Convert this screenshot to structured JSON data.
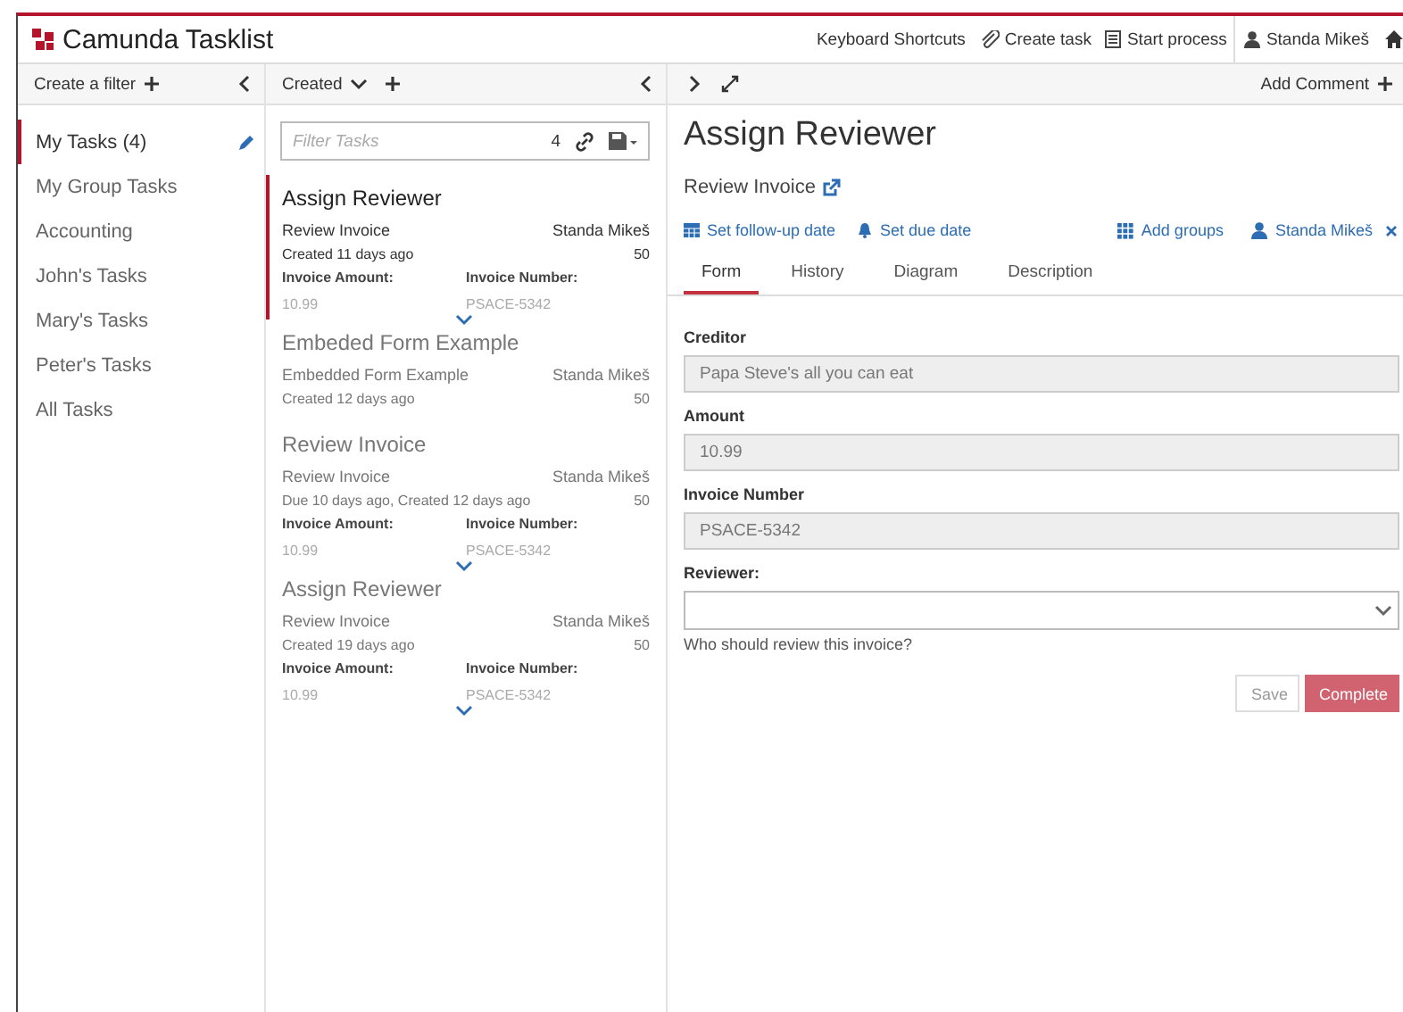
{
  "header": {
    "title": "Camunda Tasklist",
    "links": [
      {
        "kind": "text",
        "label": "Keyboard Shortcuts"
      },
      {
        "kind": "clip",
        "label": "Create task"
      },
      {
        "kind": "process",
        "label": "Start process"
      }
    ],
    "user": "Standa Mikeš"
  },
  "filters": {
    "create": "Create a filter",
    "items": [
      {
        "label": "My Tasks",
        "count": "(4)",
        "selected": true
      },
      {
        "label": "My Group Tasks",
        "selected": false
      },
      {
        "label": "Accounting",
        "selected": false
      },
      {
        "label": "John's Tasks",
        "selected": false
      },
      {
        "label": "Mary's Tasks",
        "selected": false
      },
      {
        "label": "Peter's Tasks",
        "selected": false
      },
      {
        "label": "All Tasks",
        "selected": false
      }
    ]
  },
  "list": {
    "sort": "Created",
    "search": {
      "placeholder": "Filter Tasks",
      "count": "4"
    },
    "tasks": [
      {
        "name": "Assign Reviewer",
        "process": "Review Invoice",
        "assignee": "Standa Mikeš",
        "dates": "Created 11 days ago",
        "priority": "50",
        "selected": true,
        "variables": [
          {
            "label": "Invoice Amount:",
            "value": "10.99"
          },
          {
            "label": "Invoice Number:",
            "value": "PSACE-5342"
          }
        ]
      },
      {
        "name": "Embeded Form Example",
        "process": "Embedded Form Example",
        "assignee": "Standa Mikeš",
        "dates": "Created 12 days ago",
        "priority": "50",
        "selected": false
      },
      {
        "name": "Review Invoice",
        "process": "Review Invoice",
        "assignee": "Standa Mikeš",
        "dates": "Due 10 days ago, Created 12 days ago",
        "priority": "50",
        "selected": false,
        "variables": [
          {
            "label": "Invoice Amount:",
            "value": "10.99"
          },
          {
            "label": "Invoice Number:",
            "value": "PSACE-5342"
          }
        ]
      },
      {
        "name": "Assign Reviewer",
        "process": "Review Invoice",
        "assignee": "Standa Mikeš",
        "dates": "Created 19 days ago",
        "priority": "50",
        "selected": false,
        "variables": [
          {
            "label": "Invoice Amount:",
            "value": "10.99"
          },
          {
            "label": "Invoice Number:",
            "value": "PSACE-5342"
          }
        ]
      }
    ]
  },
  "detail": {
    "add_comment": "Add Comment",
    "title": "Assign Reviewer",
    "process": "Review Invoice",
    "actions": [
      {
        "kind": "calendar",
        "label": "Set follow-up date"
      },
      {
        "kind": "bell",
        "label": "Set due date"
      },
      {
        "kind": "groups",
        "label": "Add groups"
      },
      {
        "kind": "user",
        "label": "Standa Mikeš"
      }
    ],
    "tabs": [
      {
        "label": "Form",
        "selected": true
      },
      {
        "label": "History",
        "selected": false
      },
      {
        "label": "Diagram",
        "selected": false
      },
      {
        "label": "Description",
        "selected": false
      }
    ],
    "form": [
      {
        "kind": "text",
        "label": "Creditor",
        "value": "Papa Steve's all you can eat",
        "disabled": true
      },
      {
        "kind": "text",
        "label": "Amount",
        "value": "10.99",
        "disabled": true
      },
      {
        "kind": "text",
        "label": "Invoice Number",
        "value": "PSACE-5342",
        "disabled": true
      },
      {
        "kind": "select",
        "label": "Reviewer:",
        "help": "Who should review this invoice?"
      }
    ],
    "buttons": [
      {
        "kind": "secondary",
        "label": "Save"
      },
      {
        "kind": "primary",
        "label": "Complete"
      }
    ]
  }
}
